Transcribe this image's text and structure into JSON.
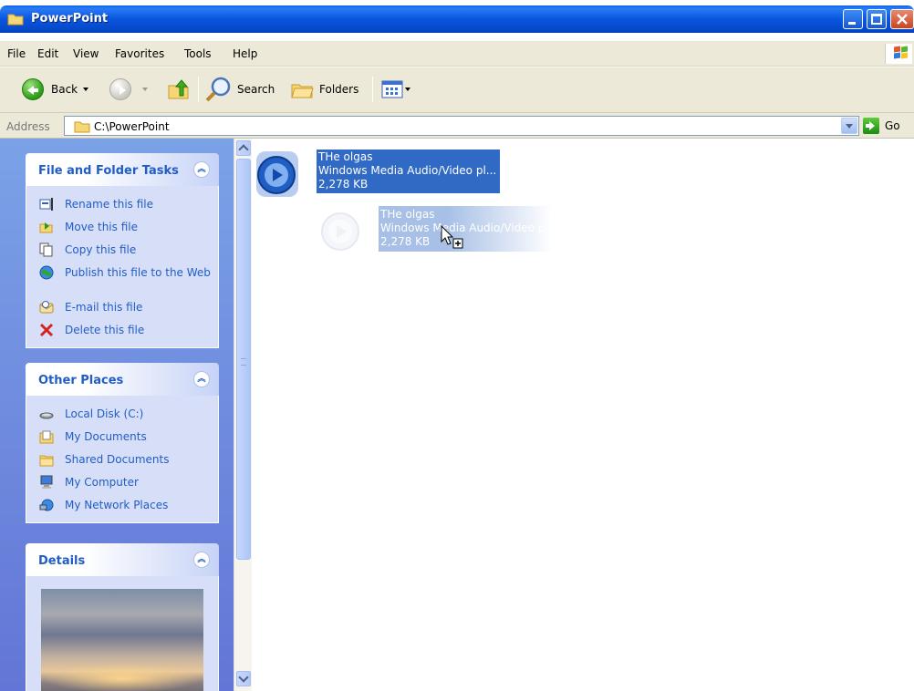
{
  "window": {
    "title": "PowerPoint",
    "accent": "#0a55de"
  },
  "menu": {
    "items": [
      "File",
      "Edit",
      "View",
      "Favorites",
      "Tools",
      "Help"
    ]
  },
  "toolbar": {
    "back_label": "Back",
    "search_label": "Search",
    "folders_label": "Folders"
  },
  "address": {
    "label": "Address",
    "path": "C:\\PowerPoint",
    "go_label": "Go"
  },
  "panels": {
    "file_tasks": {
      "title": "File and Folder Tasks",
      "items": [
        {
          "label": "Rename this file",
          "icon": "rename-icon"
        },
        {
          "label": "Move this file",
          "icon": "move-icon"
        },
        {
          "label": "Copy this file",
          "icon": "copy-icon"
        },
        {
          "label": "Publish this file to the Web",
          "icon": "publish-web-icon"
        },
        {
          "label": "E-mail this file",
          "icon": "email-icon"
        },
        {
          "label": "Delete this file",
          "icon": "delete-icon"
        }
      ]
    },
    "other_places": {
      "title": "Other Places",
      "items": [
        {
          "label": "Local Disk (C:)",
          "icon": "local-disk-icon"
        },
        {
          "label": "My Documents",
          "icon": "my-documents-icon"
        },
        {
          "label": "Shared Documents",
          "icon": "shared-documents-icon"
        },
        {
          "label": "My Computer",
          "icon": "my-computer-icon"
        },
        {
          "label": "My Network Places",
          "icon": "network-places-icon"
        }
      ]
    },
    "details": {
      "title": "Details"
    }
  },
  "file": {
    "name": "THe olgas",
    "type": "Windows Media Audio/Video pl...",
    "size": "2,278 KB",
    "drag_type": "Windows Media Audio/Video p",
    "drag_size": "2,278 KB"
  }
}
